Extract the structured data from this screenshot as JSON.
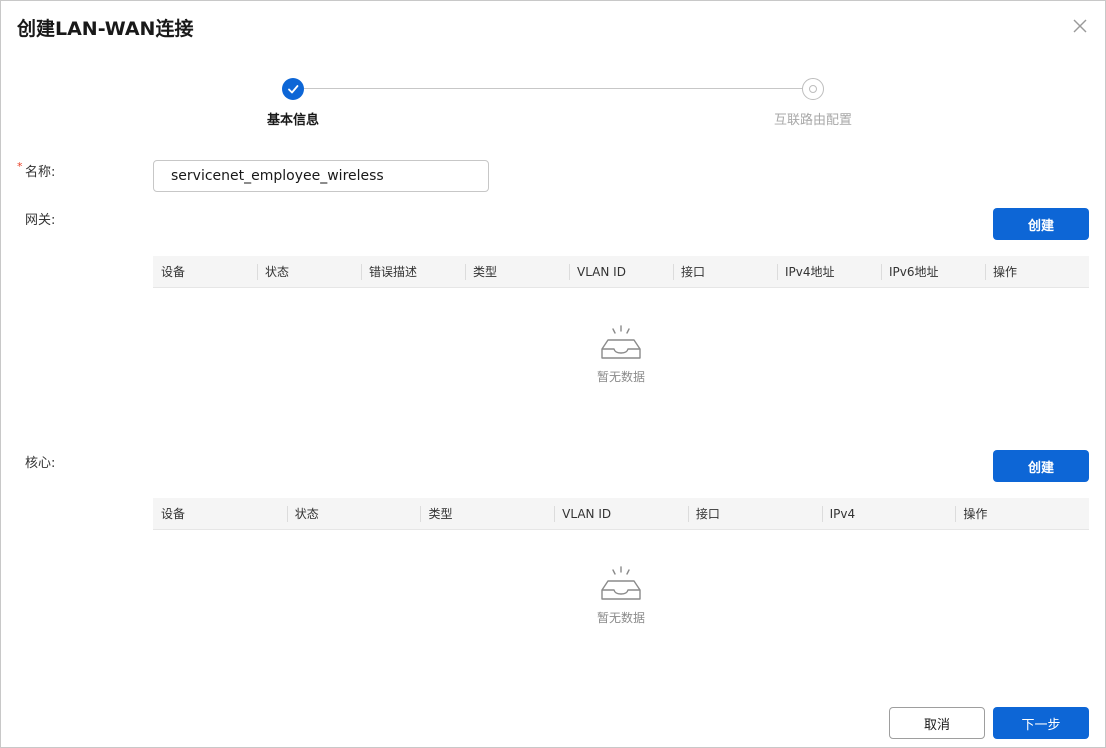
{
  "dialog": {
    "title": "创建LAN-WAN连接"
  },
  "steps": [
    {
      "label": "基本信息",
      "state": "done"
    },
    {
      "label": "互联路由配置",
      "state": "todo"
    }
  ],
  "form": {
    "name_label": "名称:",
    "name_value": "servicenet_employee_wireless",
    "required_mark": "*"
  },
  "gateway": {
    "label": "网关:",
    "create_label": "创建",
    "columns": [
      "设备",
      "状态",
      "错误描述",
      "类型",
      "VLAN ID",
      "接口",
      "IPv4地址",
      "IPv6地址",
      "操作"
    ],
    "rows": [],
    "empty_text": "暂无数据"
  },
  "core": {
    "label": "核心:",
    "create_label": "创建",
    "columns": [
      "设备",
      "状态",
      "类型",
      "VLAN ID",
      "接口",
      "IPv4",
      "操作"
    ],
    "rows": [],
    "empty_text": "暂无数据"
  },
  "footer": {
    "cancel_label": "取消",
    "next_label": "下一步"
  },
  "colors": {
    "primary": "#0d66d6",
    "required": "#e84026",
    "header_bg": "#f5f5f5"
  }
}
